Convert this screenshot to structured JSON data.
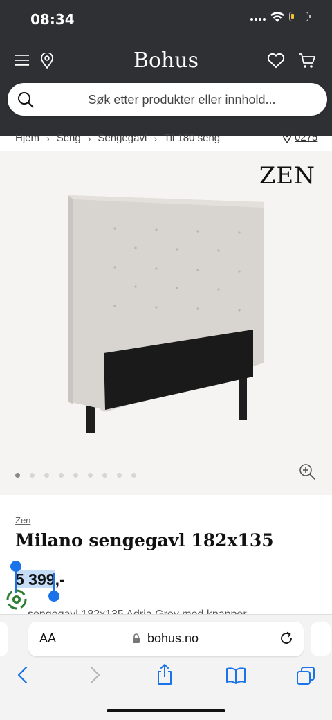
{
  "status": {
    "time": "08:34"
  },
  "header": {
    "logo": "Bohus"
  },
  "search": {
    "placeholder": "Søk etter produkter eller innhold..."
  },
  "breadcrumb": {
    "items": [
      "Hjem",
      "Seng",
      "Sengegavl",
      "Til 180 seng"
    ],
    "store_number": "0275"
  },
  "gallery": {
    "brand_logo": "ZEN",
    "image_count": 9,
    "active_index": 0
  },
  "product": {
    "brand": "Zen",
    "title": "Milano sengegavl 182x135",
    "price_selected": "5 399",
    "price_suffix": ",-",
    "description_partial": "sengegavl 182x135 Adria Grey med knapper"
  },
  "browser": {
    "aa_label": "AA",
    "domain": "bohus.no"
  },
  "colors": {
    "header_bg": "#2f3033",
    "selection": "#1a73e8",
    "accent_blue": "#1a73e8"
  }
}
